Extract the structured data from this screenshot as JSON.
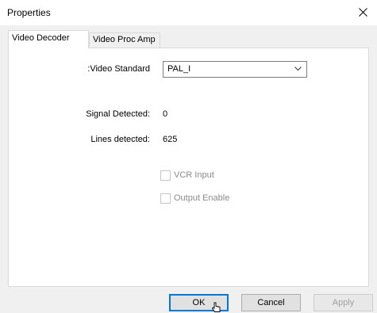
{
  "window": {
    "title": "Properties",
    "close_glyph": "close-icon"
  },
  "tabs": [
    {
      "label": "Video Decoder",
      "active": true
    },
    {
      "label": "Video Proc Amp",
      "active": false
    }
  ],
  "decoder": {
    "video_standard_label": ":Video Standard",
    "video_standard_value": "PAL_I",
    "signal_detected_label": "Signal Detected:",
    "signal_detected_value": "0",
    "lines_detected_label": "Lines detected:",
    "lines_detected_value": "625",
    "vcr_input_label": "VCR Input",
    "vcr_input_checked": false,
    "output_enable_label": "Output Enable",
    "output_enable_checked": false
  },
  "buttons": {
    "ok": "OK",
    "cancel": "Cancel",
    "apply": "Apply"
  },
  "colors": {
    "focus_border": "#0078d7",
    "disabled_text": "#a0a0a0"
  }
}
